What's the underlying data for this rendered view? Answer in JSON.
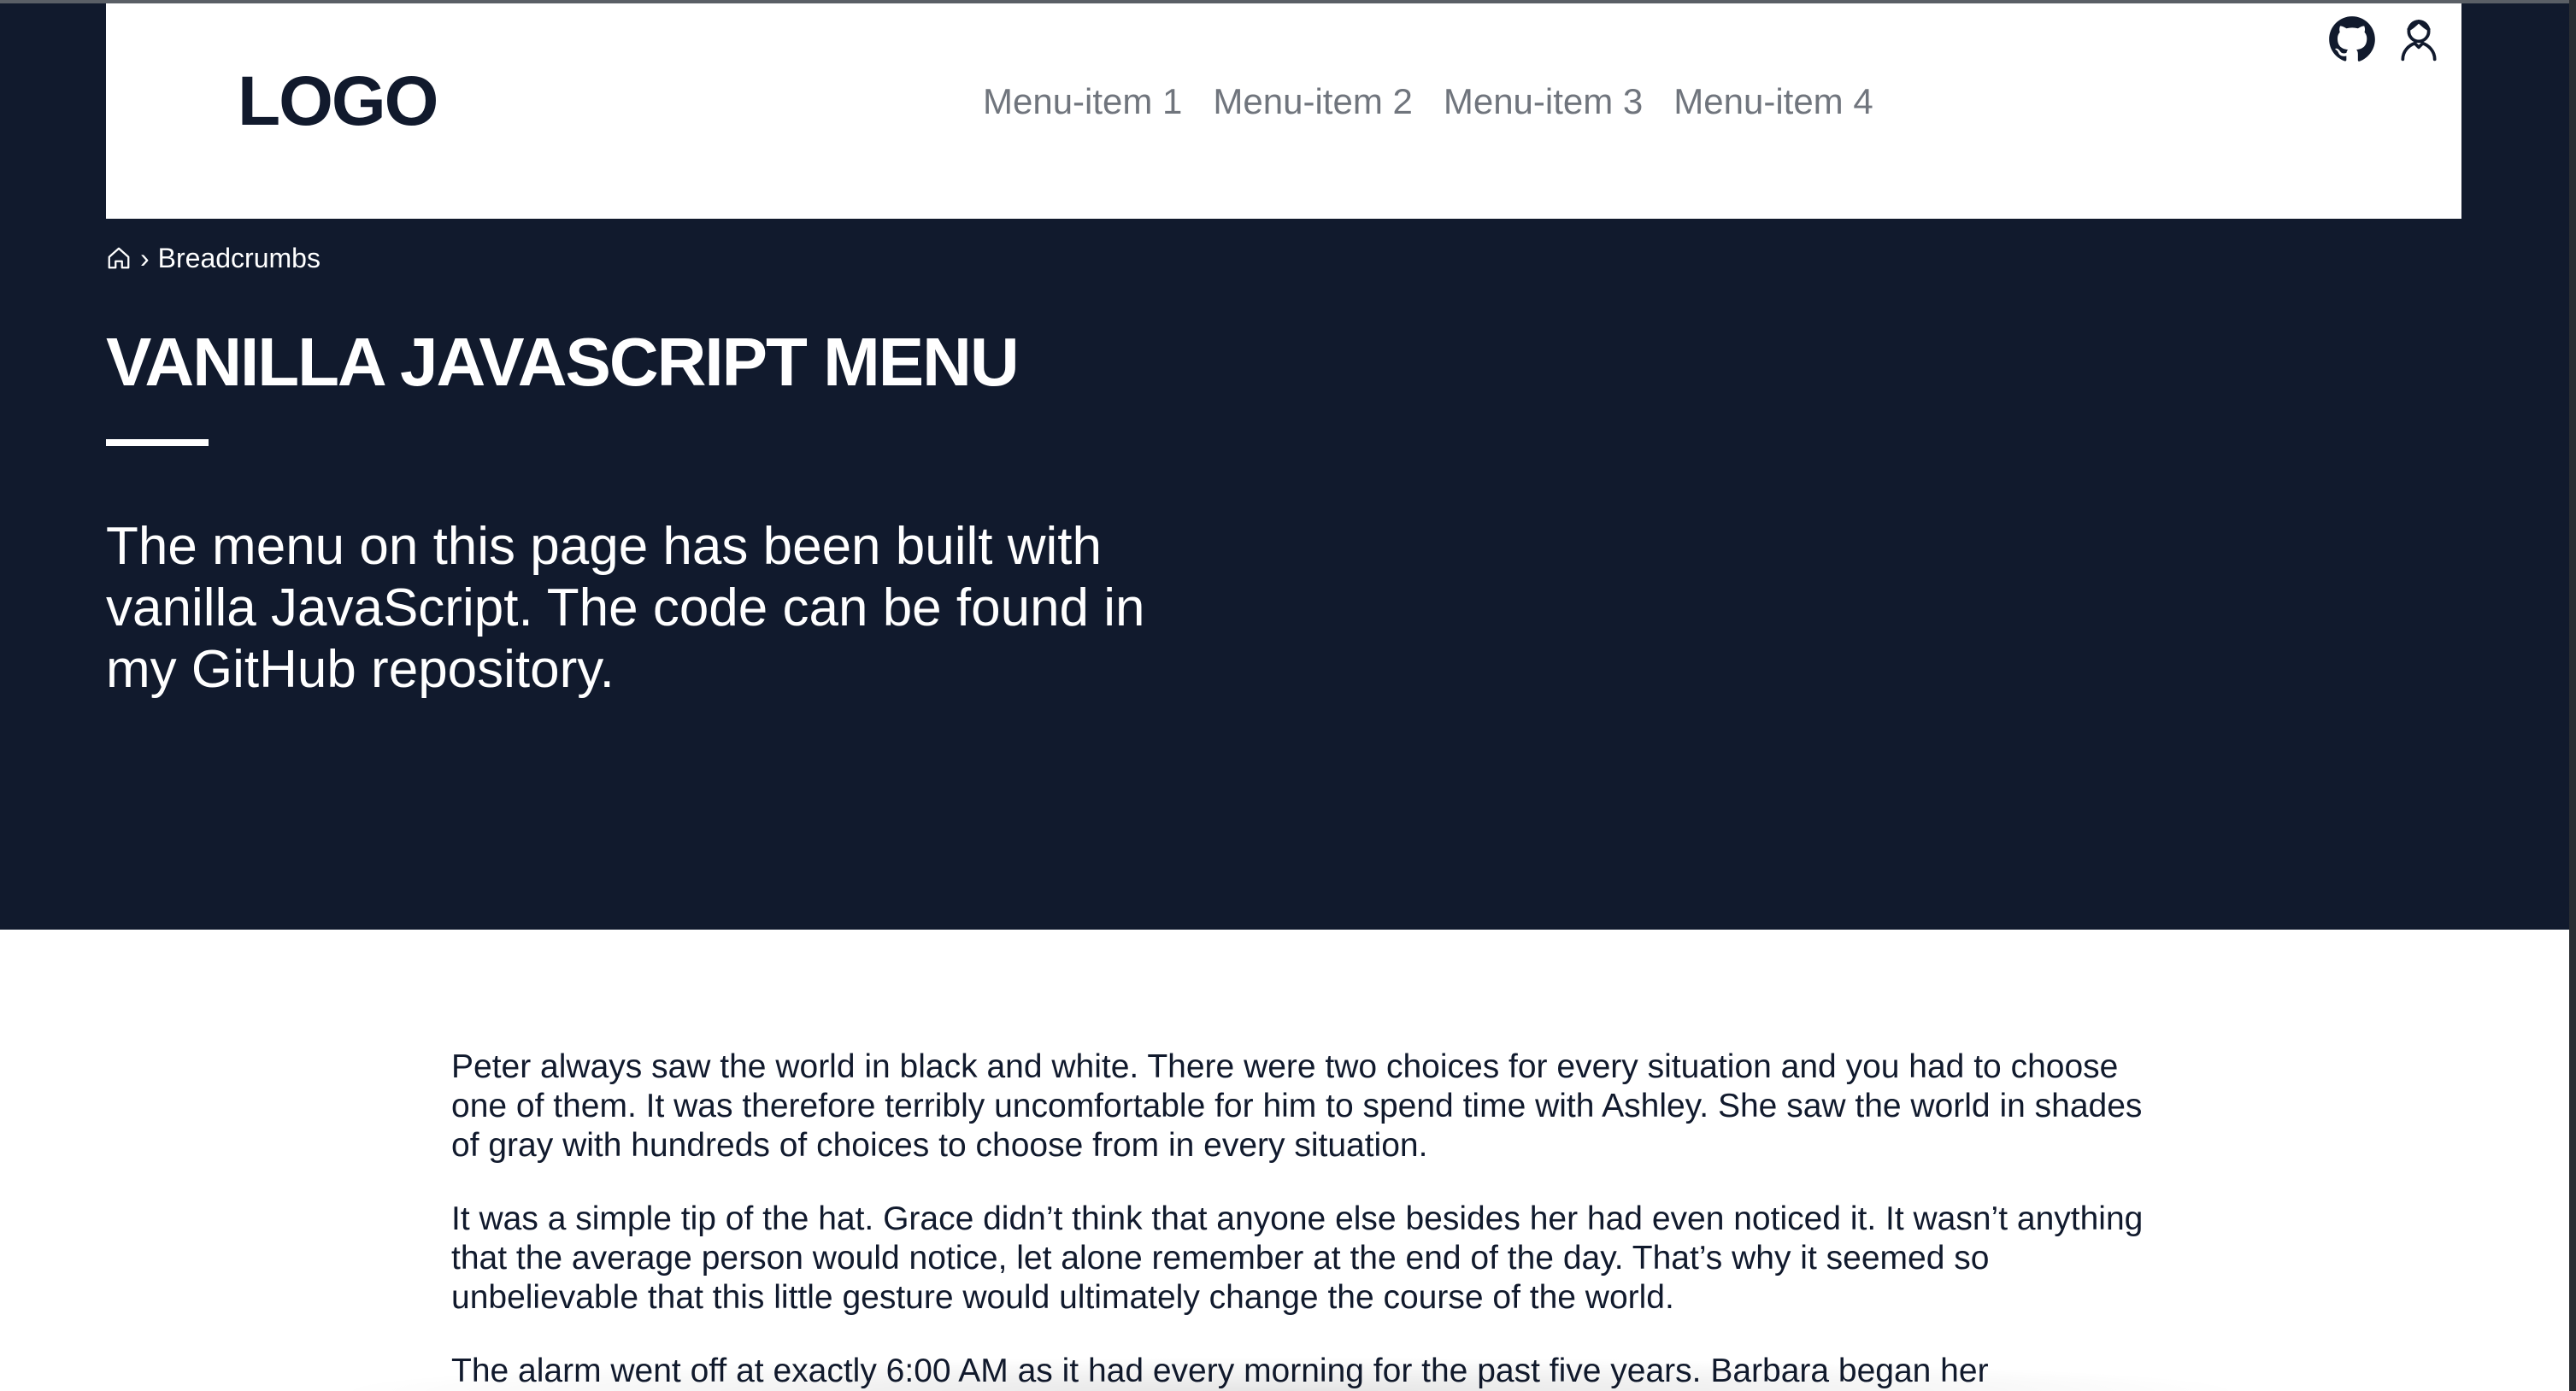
{
  "header": {
    "logo": "LOGO",
    "nav": [
      {
        "label": "Menu-item 1"
      },
      {
        "label": "Menu-item 2"
      },
      {
        "label": "Menu-item 3"
      },
      {
        "label": "Menu-item 4"
      }
    ],
    "icons": [
      "github-icon",
      "user-icon"
    ]
  },
  "breadcrumb": {
    "home_icon": "home-icon",
    "separator": "›",
    "current": "Breadcrumbs"
  },
  "hero": {
    "title": "VANILLA JAVASCRIPT MENU",
    "lead": "The menu on this page has been built with vanilla JavaScript. The code can be found in my GitHub repository."
  },
  "content": {
    "paragraphs": [
      "Peter always saw the world in black and white. There were two choices for every situation and you had to choose one of them. It was therefore terribly uncomfortable for him to spend time with Ashley. She saw the world in shades of gray with hundreds of choices to choose from in every situation.",
      "It was a simple tip of the hat. Grace didn’t think that anyone else besides her had even noticed it. It wasn’t anything that the average person would notice, let alone remember at the end of the day. That’s why it seemed so unbelievable that this little gesture would ultimately change the course of the world.",
      "The alarm went off at exactly 6:00 AM as it had every morning for the past five years. Barbara began her"
    ]
  },
  "colors": {
    "hero_background": "#111a2d",
    "header_background": "#ffffff",
    "nav_text": "#70757d",
    "body_text": "#111a2d"
  }
}
